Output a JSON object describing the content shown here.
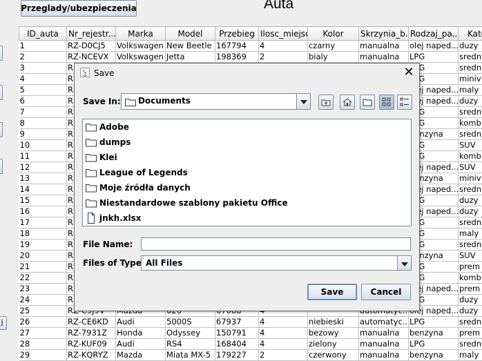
{
  "app": {
    "title": "Auta",
    "top_button": "Przeglady/ubezpieczenia",
    "side_button_label": "j"
  },
  "table": {
    "columns": [
      "ID_auta",
      "Nr_rejestr...",
      "Marka",
      "Model",
      "Przebieg",
      "Ilosc_miejsc",
      "Kolor",
      "Skrzynia_b...",
      "Rodzaj_pa...",
      "Kate"
    ],
    "rows": [
      [
        "1",
        "RZ-D0CJ5",
        "Volkswagen",
        "New Beetle",
        "167794",
        "4",
        "czarny",
        "manualna",
        "olej naped...",
        "duzy"
      ],
      [
        "2",
        "RZ-NCEVX",
        "Volkswagen",
        "Jetta",
        "198369",
        "2",
        "bialy",
        "manualna",
        "LPG",
        "sredn"
      ],
      [
        "3",
        "R",
        "",
        "",
        "",
        "",
        "",
        "",
        "LPG",
        "sredn"
      ],
      [
        "4",
        "R",
        "",
        "",
        "",
        "",
        "",
        "",
        "LPG",
        "miniv"
      ],
      [
        "5",
        "R",
        "",
        "",
        "",
        "",
        "",
        "",
        "olej naped...",
        "maly"
      ],
      [
        "6",
        "R",
        "",
        "",
        "",
        "",
        "",
        "",
        "olej naped...",
        "duzy"
      ],
      [
        "7",
        "R",
        "",
        "",
        "",
        "",
        "",
        "",
        "LPG",
        "sredn"
      ],
      [
        "8",
        "R",
        "",
        "",
        "",
        "",
        "",
        "",
        "LPG",
        "komb"
      ],
      [
        "9",
        "R",
        "",
        "",
        "",
        "",
        "",
        "",
        "benzyna",
        "sredn"
      ],
      [
        "10",
        "R",
        "",
        "",
        "",
        "",
        "",
        "",
        "LPG",
        "SUV"
      ],
      [
        "11",
        "R",
        "",
        "",
        "",
        "",
        "",
        "",
        "LPG",
        "komb"
      ],
      [
        "12",
        "R",
        "",
        "",
        "",
        "",
        "",
        "",
        "olej naped...",
        "SUV"
      ],
      [
        "13",
        "R",
        "",
        "",
        "",
        "",
        "",
        "",
        "benzyna",
        "miniv"
      ],
      [
        "14",
        "R",
        "",
        "",
        "",
        "",
        "",
        "",
        "olej naped...",
        "sredn"
      ],
      [
        "15",
        "R",
        "",
        "",
        "",
        "",
        "",
        "",
        "LPG",
        "duzy"
      ],
      [
        "16",
        "R",
        "",
        "",
        "",
        "",
        "",
        "",
        "olej naped...",
        "duzy"
      ],
      [
        "17",
        "R",
        "",
        "",
        "",
        "",
        "",
        "",
        "LPG",
        "sredn"
      ],
      [
        "18",
        "R",
        "",
        "",
        "",
        "",
        "",
        "",
        "LPG",
        "maly"
      ],
      [
        "19",
        "R",
        "",
        "",
        "",
        "",
        "",
        "",
        "LPG",
        "sredn"
      ],
      [
        "20",
        "R",
        "",
        "",
        "",
        "",
        "",
        "",
        "benzyna",
        "SUV"
      ],
      [
        "21",
        "R",
        "",
        "",
        "",
        "",
        "",
        "",
        "LPG",
        "prem"
      ],
      [
        "22",
        "R",
        "",
        "",
        "",
        "",
        "",
        "",
        "LPG",
        "komb"
      ],
      [
        "23",
        "R",
        "",
        "",
        "",
        "",
        "",
        "",
        "olej naped...",
        "prem"
      ],
      [
        "24",
        "R",
        "",
        "",
        "",
        "",
        "",
        "",
        "LPG",
        "duzy"
      ],
      [
        "25",
        "RZ-C9J9V",
        "Mazda",
        "626",
        "67088",
        "4",
        "",
        "automatyc...",
        "olej naped...",
        "duzy"
      ],
      [
        "26",
        "RZ-CE6KD",
        "Audi",
        "5000S",
        "67937",
        "4",
        "niebieski",
        "automatyc...",
        "LPG",
        "sredn"
      ],
      [
        "27",
        "RZ-7931Z",
        "Honda",
        "Odyssey",
        "150791",
        "4",
        "bezowy",
        "manualna",
        "benzyna",
        "prem"
      ],
      [
        "28",
        "RZ-KUF09",
        "Audi",
        "RS4",
        "168404",
        "4",
        "zielony",
        "manualna",
        "LPG",
        "sredn"
      ],
      [
        "29",
        "RZ-KQRYZ",
        "Mazda",
        "Miata MX-5",
        "179227",
        "2",
        "czerwony",
        "manualna",
        "benzyna",
        "maly"
      ]
    ]
  },
  "dialog": {
    "title": "Save",
    "close_glyph": "✕",
    "save_in_label": "Save In:",
    "save_in_value": "Documents",
    "files": [
      {
        "name": "Adobe",
        "type": "folder"
      },
      {
        "name": "dumps",
        "type": "folder"
      },
      {
        "name": "Klei",
        "type": "folder"
      },
      {
        "name": "League of Legends",
        "type": "folder"
      },
      {
        "name": "Moje źródła danych",
        "type": "folder"
      },
      {
        "name": "Niestandardowe szablony pakietu Office",
        "type": "folder"
      },
      {
        "name": "jnkh.xlsx",
        "type": "file"
      }
    ],
    "file_name_label": "File Name:",
    "file_name_value": "",
    "files_of_type_label": "Files of Type:",
    "files_of_type_value": "All Files",
    "save_button": "Save",
    "cancel_button": "Cancel"
  }
}
